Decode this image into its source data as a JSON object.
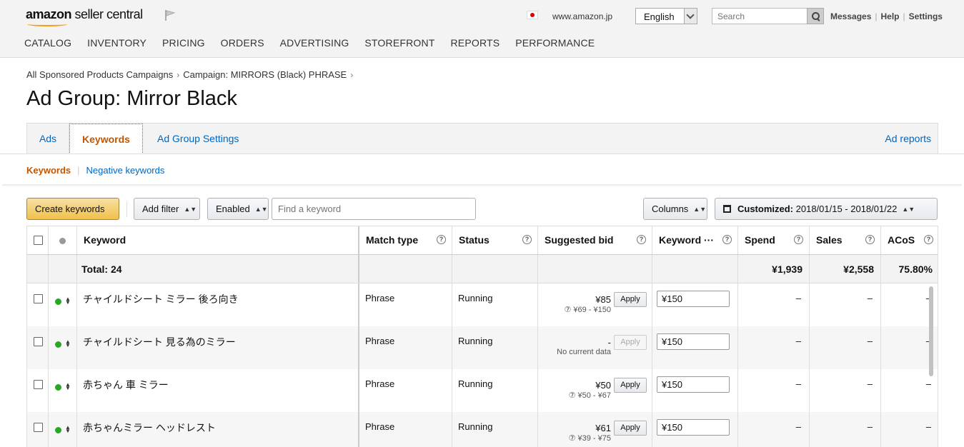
{
  "header": {
    "logo_brand": "amazon",
    "logo_rest": " seller central",
    "marketplace": "www.amazon.jp",
    "language": "English",
    "search_placeholder": "Search",
    "links": [
      "Messages",
      "Help",
      "Settings"
    ],
    "nav": [
      "CATALOG",
      "INVENTORY",
      "PRICING",
      "ORDERS",
      "ADVERTISING",
      "STOREFRONT",
      "REPORTS",
      "PERFORMANCE"
    ]
  },
  "breadcrumb": [
    "All Sponsored Products Campaigns",
    "Campaign: MIRRORS (Black) PHRASE"
  ],
  "page_title": "Ad Group: Mirror Black",
  "tabs": {
    "ads": "Ads",
    "keywords": "Keywords",
    "settings": "Ad Group Settings",
    "reports": "Ad reports"
  },
  "subnav": {
    "keywords": "Keywords",
    "negative": "Negative keywords"
  },
  "toolbar": {
    "create": "Create keywords",
    "add_filter": "Add filter",
    "enabled": "Enabled",
    "find_placeholder": "Find a keyword",
    "columns": "Columns",
    "date_label": "Customized:",
    "date_range": "2018/01/15 - 2018/01/22"
  },
  "table": {
    "headers": [
      "Keyword",
      "Match type",
      "Status",
      "Suggested bid",
      "Keyword ···",
      "Spend",
      "Sales",
      "ACoS"
    ],
    "total": {
      "label": "Total: 24",
      "spend": "¥1,939",
      "sales": "¥2,558",
      "acos": "75.80%"
    },
    "rows": [
      {
        "keyword": "チャイルドシート ミラー 後ろ向き",
        "match": "Phrase",
        "status": "Running",
        "bid": "¥85",
        "range": "⑦ ¥69 - ¥150",
        "apply": "Apply",
        "apply_disabled": false,
        "kw_bid": "¥150",
        "spend": "–",
        "sales": "–",
        "acos": "–"
      },
      {
        "keyword": "チャイルドシート 見る為のミラー",
        "match": "Phrase",
        "status": "Running",
        "bid": "-",
        "range": "No current data",
        "apply": "Apply",
        "apply_disabled": true,
        "kw_bid": "¥150",
        "spend": "–",
        "sales": "–",
        "acos": "–"
      },
      {
        "keyword": "赤ちゃん 車 ミラー",
        "match": "Phrase",
        "status": "Running",
        "bid": "¥50",
        "range": "⑦ ¥50 - ¥67",
        "apply": "Apply",
        "apply_disabled": false,
        "kw_bid": "¥150",
        "spend": "–",
        "sales": "–",
        "acos": "–"
      },
      {
        "keyword": "赤ちゃんミラー ヘッドレスト",
        "match": "Phrase",
        "status": "Running",
        "bid": "¥61",
        "range": "⑦ ¥39 - ¥75",
        "apply": "Apply",
        "apply_disabled": false,
        "kw_bid": "¥150",
        "spend": "–",
        "sales": "–",
        "acos": "–"
      }
    ]
  },
  "colors": {
    "accent_orange": "#c45500",
    "link_blue": "#0066c0",
    "primary_button": "#f0c14b",
    "status_green": "#26a825"
  }
}
